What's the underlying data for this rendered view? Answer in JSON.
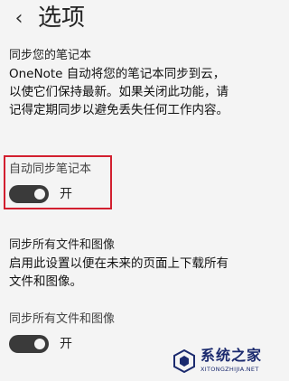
{
  "header": {
    "back_icon": "chevron-left-icon",
    "back_glyph": "‹",
    "title": "选项"
  },
  "sync_notebooks": {
    "title": "同步您的笔记本",
    "description_lines": [
      "OneNote 自动将您的笔记本同步到云，",
      "以使它们保持最新。如果关闭此功能，请",
      "记得定期同步以避免丢失任何工作内容。"
    ],
    "toggle_label": "自动同步笔记本",
    "toggle_state": "开",
    "toggle_on": true
  },
  "sync_files": {
    "title": "同步所有文件和图像",
    "description_lines": [
      "启用此设置以便在未来的页面上下载所有",
      "文件和图像。"
    ],
    "toggle_label": "同步所有文件和图像",
    "toggle_state": "开",
    "toggle_on": true
  },
  "watermark": {
    "text": "系统之家",
    "subtext": "XITONGZHIJIA.NET"
  },
  "colors": {
    "background": "#f4f4f4",
    "highlight_border": "#d21f2f",
    "toggle_track": "#3a3a3a",
    "watermark": "#1b2a6e"
  }
}
